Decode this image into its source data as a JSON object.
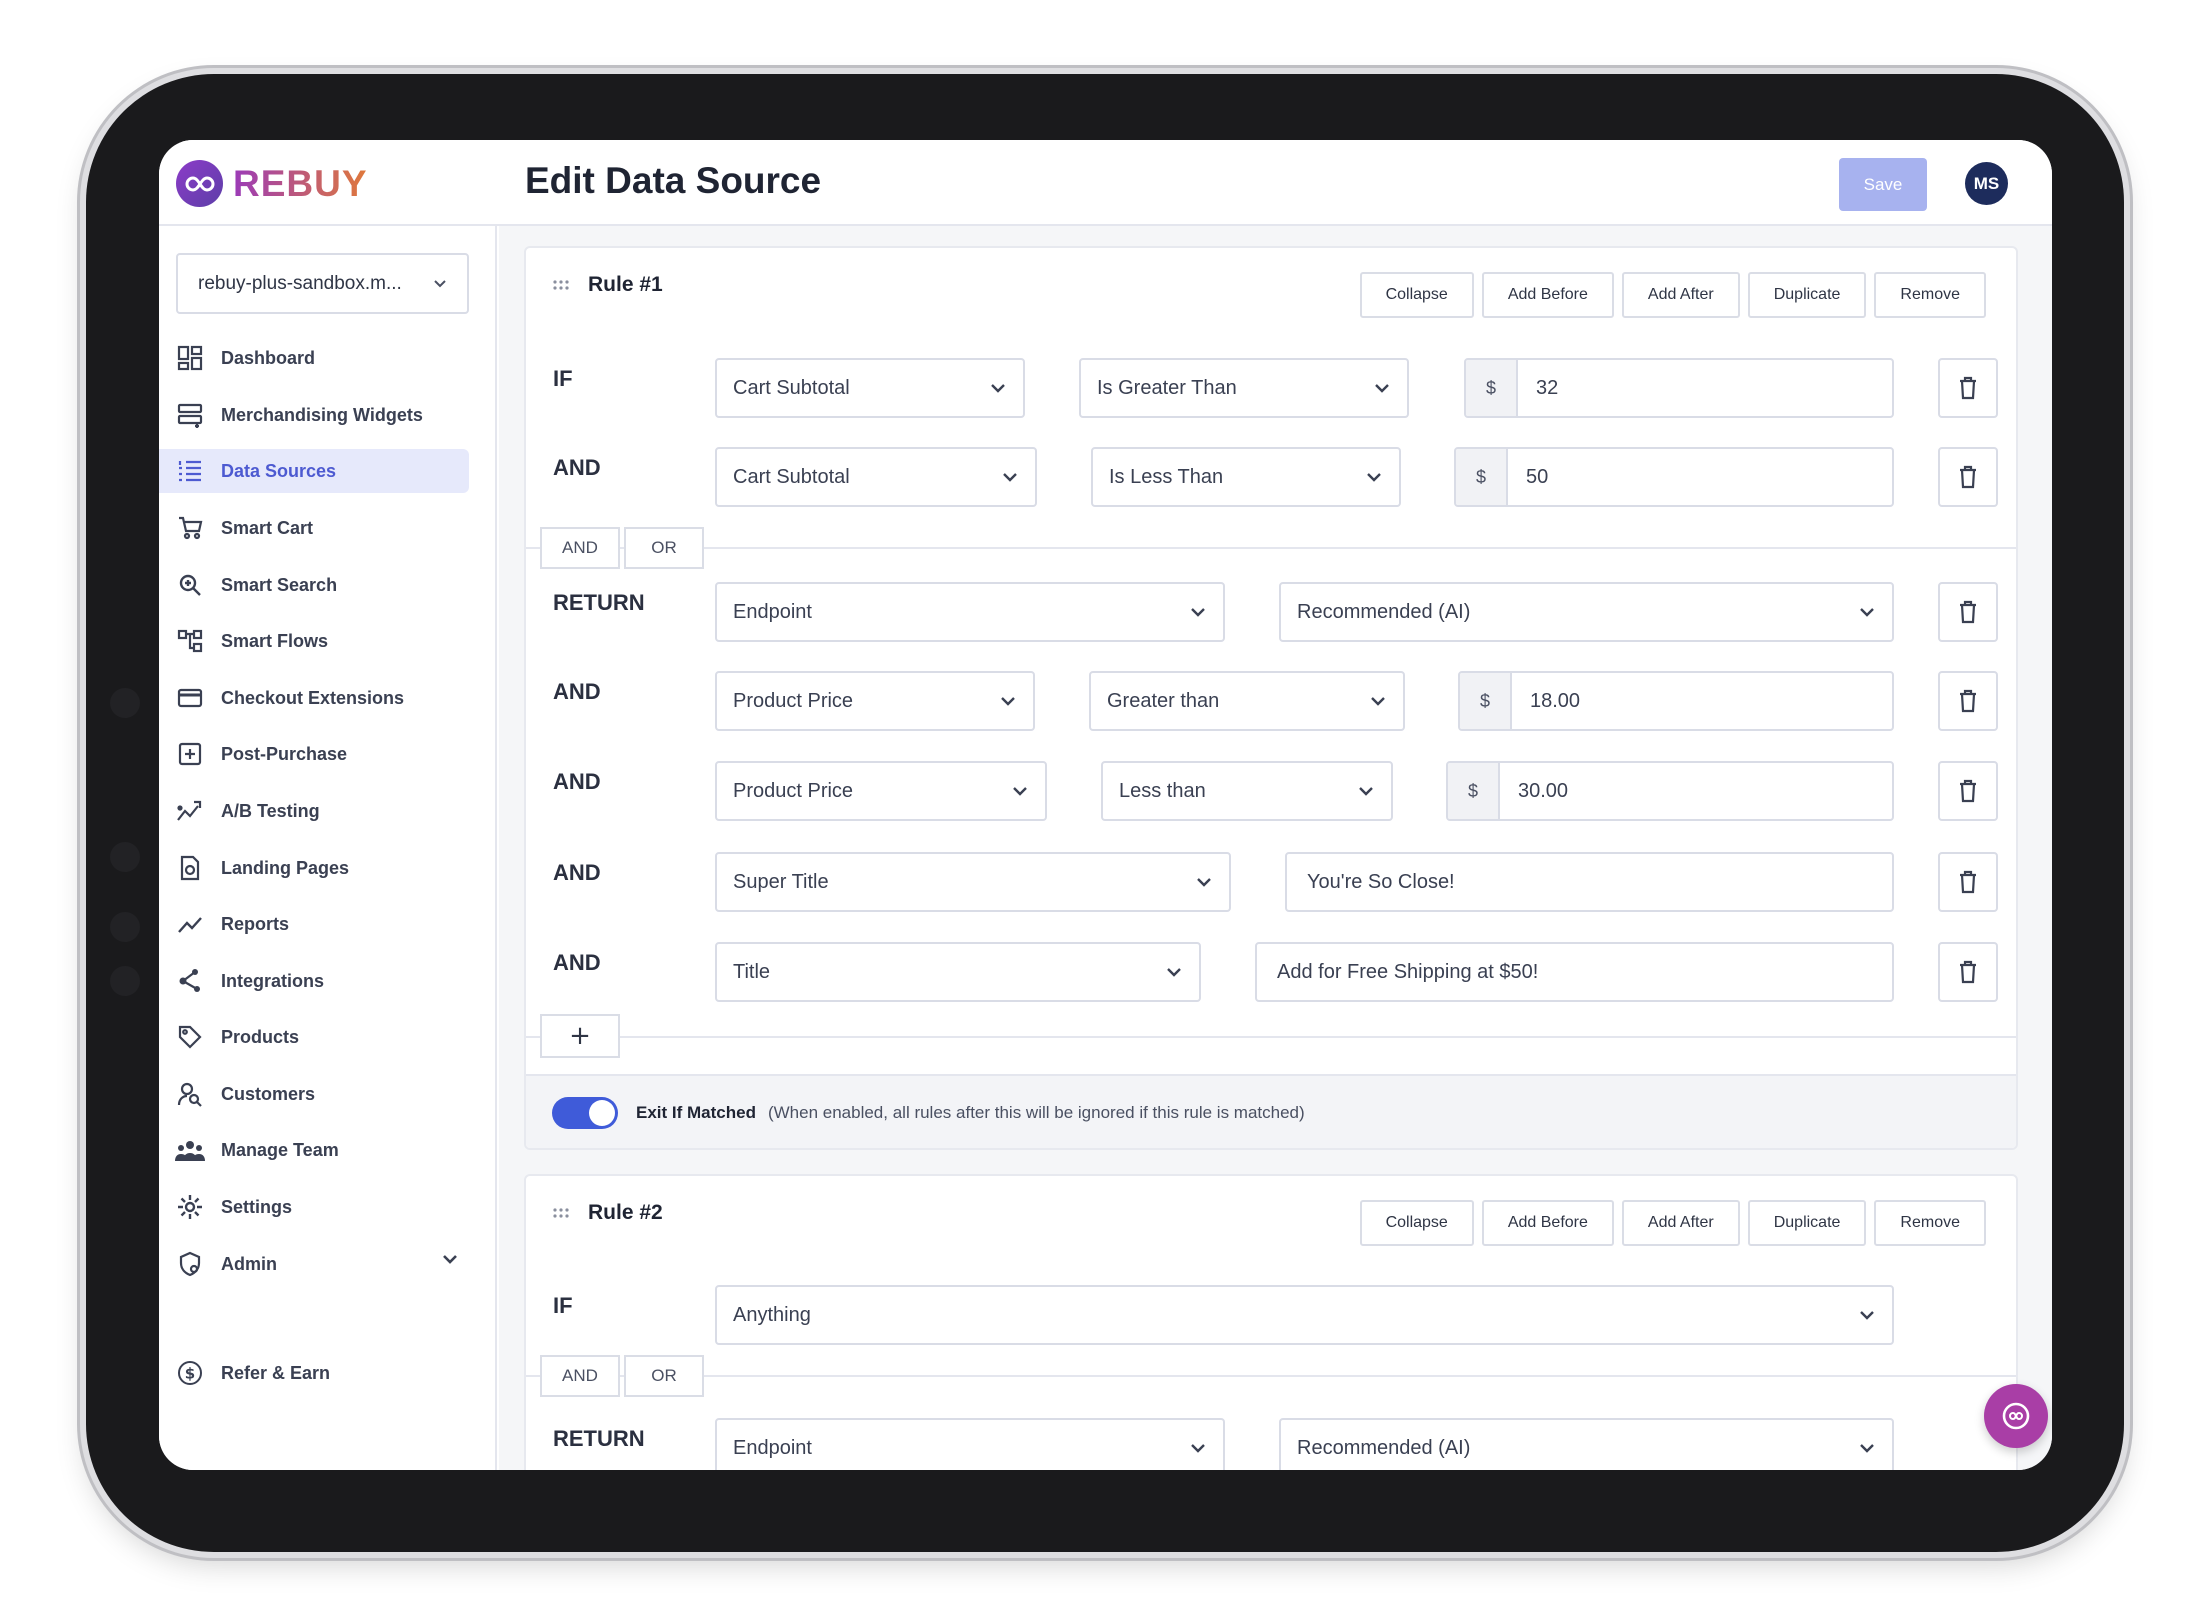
{
  "app": {
    "brand": "REBUY",
    "page_title": "Edit Data Source",
    "save_label": "Save",
    "user_initials": "MS"
  },
  "sidebar": {
    "store": "rebuy-plus-sandbox.m...",
    "items": [
      {
        "label": "Dashboard",
        "icon": "dashboard-icon"
      },
      {
        "label": "Merchandising Widgets",
        "icon": "widgets-icon"
      },
      {
        "label": "Data Sources",
        "icon": "list-icon",
        "active": true
      },
      {
        "label": "Smart Cart",
        "icon": "cart-icon"
      },
      {
        "label": "Smart Search",
        "icon": "search-icon"
      },
      {
        "label": "Smart Flows",
        "icon": "flows-icon"
      },
      {
        "label": "Checkout Extensions",
        "icon": "card-icon"
      },
      {
        "label": "Post-Purchase",
        "icon": "plus-square-icon"
      },
      {
        "label": "A/B Testing",
        "icon": "ab-test-icon"
      },
      {
        "label": "Landing Pages",
        "icon": "landing-page-icon"
      },
      {
        "label": "Reports",
        "icon": "chart-line-icon"
      },
      {
        "label": "Integrations",
        "icon": "integrations-icon"
      },
      {
        "label": "Products",
        "icon": "tag-icon"
      },
      {
        "label": "Customers",
        "icon": "customers-icon"
      },
      {
        "label": "Manage Team",
        "icon": "team-icon"
      },
      {
        "label": "Settings",
        "icon": "gear-icon"
      },
      {
        "label": "Admin",
        "icon": "shield-icon"
      }
    ],
    "refer": {
      "label": "Refer & Earn",
      "icon": "dollar-icon"
    }
  },
  "rule_actions": {
    "collapse": "Collapse",
    "add_before": "Add Before",
    "add_after": "Add After",
    "duplicate": "Duplicate",
    "remove": "Remove"
  },
  "logic": {
    "if": "IF",
    "and": "AND",
    "return": "RETURN",
    "and_btn": "AND",
    "or_btn": "OR",
    "add": "+"
  },
  "rule1": {
    "title": "Rule #1",
    "cond1": {
      "field": "Cart Subtotal",
      "op": "Is Greater Than",
      "currency": "$",
      "value": "32"
    },
    "cond2": {
      "field": "Cart Subtotal",
      "op": "Is Less Than",
      "currency": "$",
      "value": "50"
    },
    "return": {
      "type": "Endpoint",
      "value": "Recommended (AI)"
    },
    "ret2": {
      "field": "Product Price",
      "op": "Greater than",
      "currency": "$",
      "value": "18.00"
    },
    "ret3": {
      "field": "Product Price",
      "op": "Less than",
      "currency": "$",
      "value": "30.00"
    },
    "ret4": {
      "field": "Super Title",
      "value": "You're So Close!"
    },
    "ret5": {
      "field": "Title",
      "value": "Add for Free Shipping at $50!"
    },
    "exit_label": "Exit If Matched",
    "exit_desc": "(When enabled, all rules after this will be ignored if this rule is matched)",
    "exit_enabled": true
  },
  "rule2": {
    "title": "Rule #2",
    "cond1": {
      "field": "Anything"
    },
    "return": {
      "type": "Endpoint",
      "value": "Recommended (AI)"
    }
  },
  "colors": {
    "accent": "#4d5ad1",
    "save_disabled": "#a7b2ef",
    "toggle_on": "#3f5bd9",
    "chat": "#a93ea6"
  }
}
